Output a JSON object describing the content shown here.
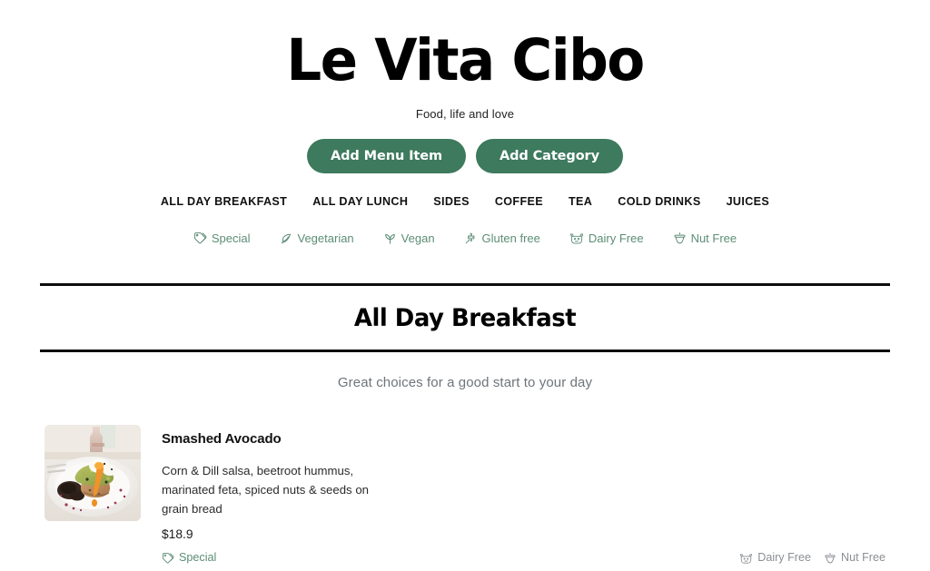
{
  "header": {
    "title": "Le Vita Cibo",
    "tagline": "Food, life and love"
  },
  "actions": {
    "add_menu_item_label": "Add Menu Item",
    "add_category_label": "Add Category"
  },
  "category_nav": {
    "items": [
      {
        "label": "ALL DAY BREAKFAST",
        "name": "nav-all-day-breakfast"
      },
      {
        "label": "ALL DAY LUNCH",
        "name": "nav-all-day-lunch"
      },
      {
        "label": "SIDES",
        "name": "nav-sides"
      },
      {
        "label": "COFFEE",
        "name": "nav-coffee"
      },
      {
        "label": "TEA",
        "name": "nav-tea"
      },
      {
        "label": "COLD DRINKS",
        "name": "nav-cold-drinks"
      },
      {
        "label": "JUICES",
        "name": "nav-juices"
      }
    ]
  },
  "legend": {
    "items": [
      {
        "label": "Special",
        "icon": "tag-icon"
      },
      {
        "label": "Vegetarian",
        "icon": "leaf-icon"
      },
      {
        "label": "Vegan",
        "icon": "sprout-icon"
      },
      {
        "label": "Gluten free",
        "icon": "wheat-icon"
      },
      {
        "label": "Dairy Free",
        "icon": "cow-icon"
      },
      {
        "label": "Nut Free",
        "icon": "acorn-icon"
      }
    ]
  },
  "section": {
    "title": "All Day Breakfast",
    "subtitle": "Great choices for a good start to your day"
  },
  "menu_items": [
    {
      "name": "Smashed Avocado",
      "description": "Corn & Dill salsa, beetroot hummus, marinated feta, spiced nuts & seeds on grain bread",
      "price": "$18.9",
      "image_alt": "smashed-avocado-photo",
      "tags_left": [
        {
          "label": "Special",
          "icon": "tag-icon"
        }
      ],
      "tags_right": [
        {
          "label": "Dairy Free",
          "icon": "cow-icon"
        },
        {
          "label": "Nut Free",
          "icon": "acorn-icon"
        }
      ]
    }
  ],
  "colors": {
    "brand_green": "#3d7a5e",
    "tag_green": "#5c8d76",
    "tag_gray": "#8a8f94",
    "subtitle_gray": "#6f7479",
    "rule_black": "#0d0d0d",
    "background": "#ffffff"
  }
}
